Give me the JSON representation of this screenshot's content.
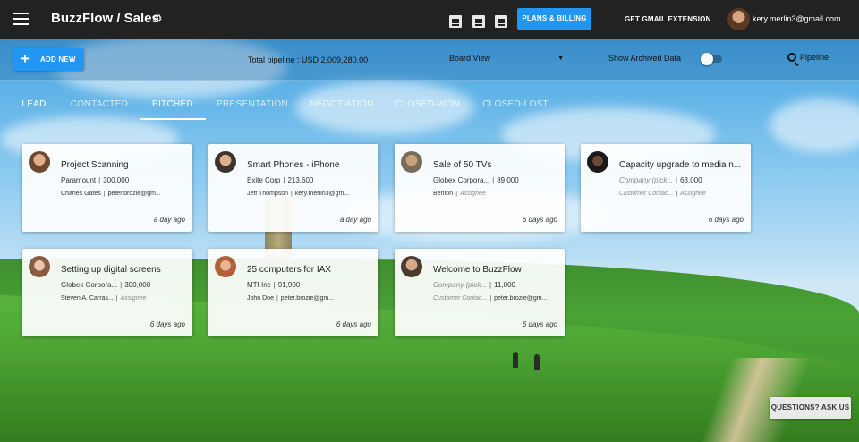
{
  "header": {
    "app_title": "BuzzFlow / Sales",
    "plans_button": "PLANS & BILLING",
    "gmail_extension": "GET GMAIL EXTENSION",
    "user_email": "kery.merlin3@gmail.com"
  },
  "toolbar": {
    "add_new": "ADD NEW",
    "total_pipeline": "Total pipeline : USD 2,009,280.00",
    "view_select": "Board View",
    "show_archived": "Show Archived Data",
    "archived_on": false,
    "search_label": "Pipeline"
  },
  "tabs": [
    {
      "label": "LEAD"
    },
    {
      "label": "CONTACTED"
    },
    {
      "label": "PITCHED",
      "active": true
    },
    {
      "label": "PRESENTATION"
    },
    {
      "label": "NEGOTIATION"
    },
    {
      "label": "CLOSED-WON"
    },
    {
      "label": "CLOSED-LOST"
    }
  ],
  "cards": [
    {
      "title": "Project Scanning",
      "company": "Paramount",
      "value": "300,000",
      "contact": "Charles Gates",
      "assignee": "peter.brozie@gm...",
      "time": "a day ago"
    },
    {
      "title": "Smart Phones - iPhone",
      "company": "Exite Corp",
      "value": "213,600",
      "contact": "Jeff Thompson",
      "assignee": "kery.merlin3@gm...",
      "time": "a day ago"
    },
    {
      "title": "Sale of 50 TVs",
      "company": "Globex Corpora...",
      "value": "89,000",
      "contact": "Benton",
      "assignee": "Assignee",
      "time": "6 days ago"
    },
    {
      "title": "Capacity upgrade to media n...",
      "company": "Company (pick...",
      "value": "63,000",
      "contact": "Customer Contac...",
      "assignee": "Assignee",
      "time": "6 days ago"
    },
    {
      "title": "Setting up digital screens",
      "company": "Globex Corpora...",
      "value": "300,000",
      "contact": "Steven A. Carras...",
      "assignee": "Assignee",
      "time": "6 days ago"
    },
    {
      "title": "25 computers for IAX",
      "company": "MTI Inc",
      "value": "91,900",
      "contact": "John Doe",
      "assignee": "peter.brozie@gm...",
      "time": "6 days ago"
    },
    {
      "title": "Welcome to BuzzFlow",
      "company": "Company (pick...",
      "value": "11,000",
      "contact": "Customer Contac...",
      "assignee": "peter.brozie@gm...",
      "time": "6 days ago"
    }
  ],
  "help_button": "QUESTIONS? ASK US",
  "icons": {
    "menu": "menu-icon",
    "settings": "gear-icon",
    "contacts": "contacts-icon",
    "companies": "company-icon",
    "tasks": "clipboard-icon",
    "search": "search-icon"
  },
  "colors": {
    "accent": "#2196f3",
    "topbar": "#222222"
  }
}
